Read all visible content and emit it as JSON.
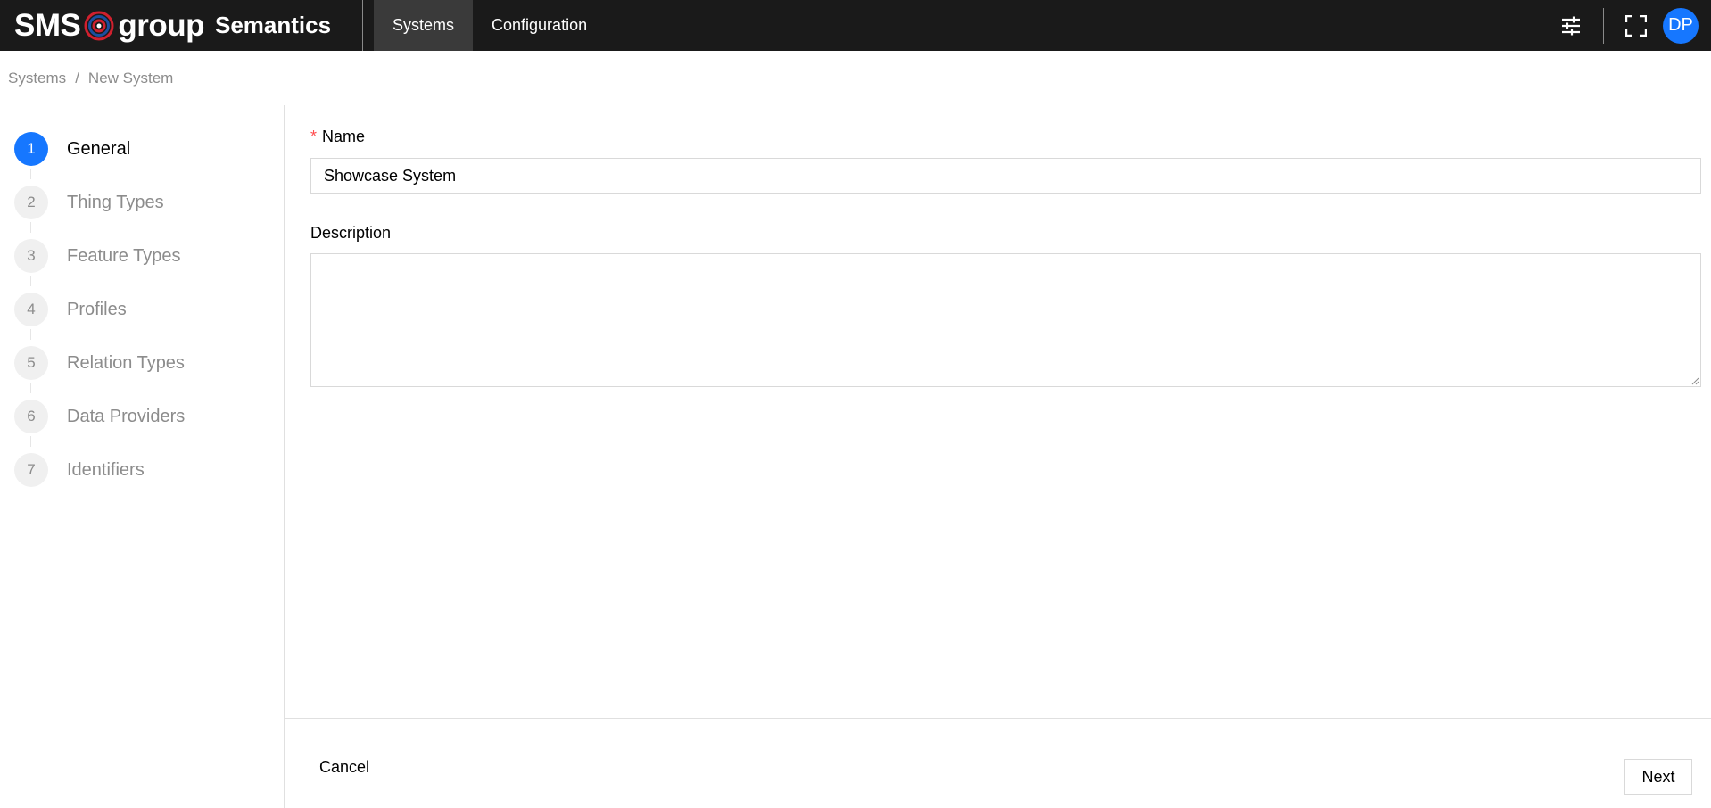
{
  "header": {
    "logo_text_left": "SMS",
    "logo_text_right": "group",
    "app_name": "Semantics",
    "nav": [
      {
        "label": "Systems",
        "active": true
      },
      {
        "label": "Configuration",
        "active": false
      }
    ],
    "icons": [
      "sliders-icon",
      "fullscreen-icon"
    ],
    "avatar_initials": "DP",
    "colors": {
      "bar": "#1a1a1a",
      "active_tab": "#3a3a3a",
      "accent": "#1677ff",
      "logo_red": "#d0202e",
      "logo_blue": "#1a4fa0"
    }
  },
  "breadcrumb": {
    "items": [
      "Systems",
      "New System"
    ],
    "separator": "/"
  },
  "steps": [
    {
      "number": "1",
      "label": "General",
      "active": true
    },
    {
      "number": "2",
      "label": "Thing Types",
      "active": false
    },
    {
      "number": "3",
      "label": "Feature Types",
      "active": false
    },
    {
      "number": "4",
      "label": "Profiles",
      "active": false
    },
    {
      "number": "5",
      "label": "Relation Types",
      "active": false
    },
    {
      "number": "6",
      "label": "Data Providers",
      "active": false
    },
    {
      "number": "7",
      "label": "Identifiers",
      "active": false
    }
  ],
  "form": {
    "name": {
      "required_mark": "*",
      "label": "Name",
      "value": "Showcase System"
    },
    "description": {
      "label": "Description",
      "value": ""
    }
  },
  "footer": {
    "cancel_label": "Cancel",
    "next_label": "Next"
  }
}
